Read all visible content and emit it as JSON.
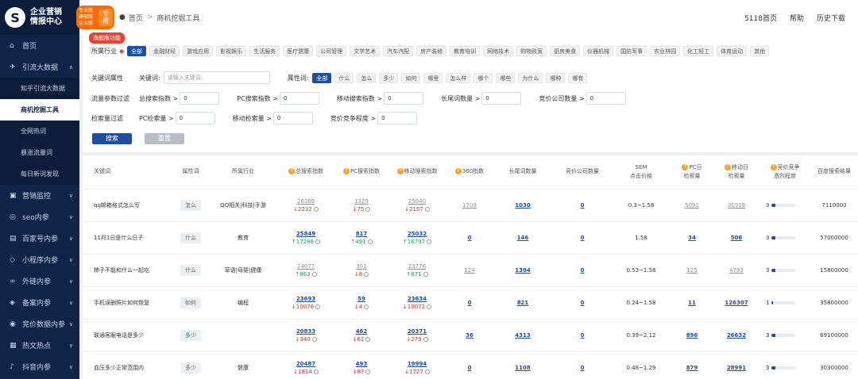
{
  "brand": {
    "logo_letter": "S",
    "line1": "企业营销",
    "line2": "情报中心"
  },
  "edition": {
    "lines": [
      "专业版",
      "旗舰版",
      "企业版"
    ],
    "label": "专用"
  },
  "breadcrumb": {
    "home": "首页",
    "sep": ">",
    "current": "商机挖掘工具"
  },
  "top_links": [
    "5118首页",
    "帮助",
    "历史下载"
  ],
  "sidebar": [
    {
      "icon": "home-icon",
      "glyph": "⌂",
      "label": "首页",
      "arrow": ""
    },
    {
      "icon": "traffic-icon",
      "glyph": "✈",
      "label": "引流大数据",
      "arrow": "∧"
    },
    {
      "label": "知乎引流大数据",
      "sub": true
    },
    {
      "label": "商机挖掘工具",
      "sub": true,
      "active": true
    },
    {
      "label": "全网热词",
      "sub": true
    },
    {
      "label": "暴涨流量词",
      "sub": true
    },
    {
      "label": "每日新词发现",
      "sub": true
    },
    {
      "icon": "monitor-icon",
      "glyph": "▣",
      "label": "营销监控",
      "arrow": "∨"
    },
    {
      "icon": "seo-icon",
      "glyph": "◎",
      "label": "seo内参",
      "arrow": "∨"
    },
    {
      "icon": "baijia-icon",
      "glyph": "▤",
      "label": "百家号内参",
      "arrow": "∨"
    },
    {
      "icon": "miniapp-icon",
      "glyph": "◇",
      "label": "小程序内参",
      "arrow": "∨"
    },
    {
      "icon": "link-icon",
      "glyph": "∞",
      "label": "外链内参",
      "arrow": "∨"
    },
    {
      "icon": "record-icon",
      "glyph": "◈",
      "label": "备案内参",
      "arrow": "∨"
    },
    {
      "icon": "bid-icon",
      "glyph": "◉",
      "label": "竞价数据内参",
      "arrow": "∨"
    },
    {
      "icon": "hot-icon",
      "glyph": "▦",
      "label": "热文热点",
      "arrow": "∨"
    },
    {
      "icon": "douyin-icon",
      "glyph": "♪",
      "label": "抖音内参",
      "arrow": "∨"
    }
  ],
  "filters": {
    "flag": "旗舰版功能",
    "industry_label": "所属行业",
    "industries": [
      "全部",
      "金融财经",
      "游戏应用",
      "影视娱乐",
      "生活服务",
      "医疗健康",
      "公司管理",
      "文学艺术",
      "汽车汽配",
      "房产装修",
      "教育培训",
      "网络技术",
      "购物败家",
      "厨房美食",
      "仪器机械",
      "国防军事",
      "农业林园",
      "化工轻工",
      "体育运动",
      "其他"
    ],
    "attr_section": "关键词属性",
    "keyword_label": "关键词:",
    "keyword_placeholder": "请输入关键词",
    "attr_label": "属性词:",
    "attrs": [
      "全部",
      "什么",
      "怎么",
      "多少",
      "如何",
      "哪里",
      "怎么样",
      "哪个",
      "哪些",
      "为什么",
      "哪种",
      "哪有"
    ],
    "flow_section": "流量参数过滤",
    "flow_fields": [
      {
        "label": "总搜索指数 >",
        "value": "0"
      },
      {
        "label": "PC搜索指数 >",
        "value": "0"
      },
      {
        "label": "移动搜索指数 >",
        "value": "0"
      },
      {
        "label": "长尾词数量 >",
        "value": "0"
      },
      {
        "label": "竞价公司数量 >",
        "value": "0"
      }
    ],
    "search_section": "检索量过滤",
    "search_fields": [
      {
        "label": "PC检索量 >",
        "value": "0"
      },
      {
        "label": "移动检索量 >",
        "value": "0"
      },
      {
        "label": "竞价竞争程度 >",
        "value": "0"
      }
    ],
    "search_button": "搜索",
    "reset_button": "重置"
  },
  "table": {
    "headers": [
      {
        "text": "关键词"
      },
      {
        "text": "属性词"
      },
      {
        "text": "所属行业"
      },
      {
        "text": "总搜索指数",
        "q": true
      },
      {
        "text": "PC搜索指数",
        "q": true
      },
      {
        "text": "移动搜索指数",
        "q": true
      },
      {
        "text": "360指数",
        "q": true
      },
      {
        "text": "长尾词数量"
      },
      {
        "text": "竞价公司数量"
      },
      {
        "text": "SEM",
        "text2": "点击价格"
      },
      {
        "text": "PC日",
        "text2": "检索量",
        "q": true
      },
      {
        "text": "移动日",
        "text2": "检索量",
        "q": true
      },
      {
        "text": "竞价竞争",
        "text2": "激烈程度",
        "q": true
      },
      {
        "text": "百度搜索结果"
      }
    ],
    "rows": [
      {
        "keyword": "qq邮箱格式怎么写",
        "attr": "怎么",
        "industry": "QQ相关|科技|手游",
        "total": "26369",
        "total_d": "2232",
        "total_dir": "down",
        "total_link": false,
        "pc": "1329",
        "pc_d": "75",
        "pc_dir": "down",
        "pc_link": false,
        "mob": "25040",
        "mob_d": "2157",
        "mob_dir": "down",
        "mob_link": false,
        "i360": "1709",
        "i360_link": false,
        "longtail": "1030",
        "bid_co": "0",
        "sem": "0.3~1.58",
        "pc_day": "5091",
        "pc_day_link": false,
        "mob_day": "31918",
        "mob_day_link": false,
        "comp": "3",
        "comp_level": 0.15,
        "baidu": "7110000"
      },
      {
        "keyword": "11月1日是什么日子",
        "attr": "什么",
        "industry": "教育",
        "total": "25849",
        "total_d": "17288",
        "total_dir": "up",
        "total_link": true,
        "pc": "817",
        "pc_d": "491",
        "pc_dir": "up",
        "pc_link": true,
        "mob": "25032",
        "mob_d": "16797",
        "mob_dir": "up",
        "mob_link": true,
        "i360": "0",
        "i360_link": true,
        "longtail": "146",
        "bid_co": "0",
        "sem": "1.58",
        "pc_day": "34",
        "pc_day_link": true,
        "mob_day": "506",
        "mob_day_link": true,
        "comp": "3",
        "comp_level": 0.15,
        "baidu": "57000000"
      },
      {
        "keyword": "柿子不能和什么一起吃",
        "attr": "什么",
        "industry": "草语|母婴|健康",
        "total": "24077",
        "total_d": "863",
        "total_dir": "up",
        "total_link": false,
        "pc": "301",
        "pc_d": "8",
        "pc_dir": "down",
        "pc_link": false,
        "mob": "23776",
        "mob_d": "871",
        "mob_dir": "up",
        "mob_link": false,
        "i360": "124",
        "i360_link": false,
        "longtail": "1394",
        "bid_co": "0",
        "sem": "0.53~1.58",
        "pc_day": "125",
        "pc_day_link": false,
        "mob_day": "4793",
        "mob_day_link": false,
        "comp": "3",
        "comp_level": 0.15,
        "baidu": "15800000"
      },
      {
        "keyword": "手机误删照片如何恢复",
        "attr": "如何",
        "industry": "编程",
        "total": "23693",
        "total_d": "10076",
        "total_dir": "down",
        "total_link": true,
        "pc": "59",
        "pc_d": "4",
        "pc_dir": "down",
        "pc_link": true,
        "mob": "23634",
        "mob_d": "10072",
        "mob_dir": "down",
        "mob_link": true,
        "i360": "0",
        "i360_link": true,
        "longtail": "821",
        "bid_co": "0",
        "sem": "0.24~1.58",
        "pc_day": "11",
        "pc_day_link": true,
        "mob_day": "126307",
        "mob_day_link": true,
        "comp": "1",
        "comp_level": 0.05,
        "baidu": "35800000"
      },
      {
        "keyword": "联通客服电话是多少",
        "attr": "多少",
        "industry": "",
        "total": "20833",
        "total_d": "340",
        "total_dir": "down",
        "total_link": true,
        "pc": "462",
        "pc_d": "61",
        "pc_dir": "down",
        "pc_link": true,
        "mob": "20371",
        "mob_d": "279",
        "mob_dir": "down",
        "mob_link": true,
        "i360": "36",
        "i360_link": true,
        "longtail": "4313",
        "bid_co": "0",
        "sem": "0.39~2.12",
        "pc_day": "896",
        "pc_day_link": true,
        "mob_day": "26632",
        "mob_day_link": true,
        "comp": "3",
        "comp_level": 0.15,
        "baidu": "69100000"
      },
      {
        "keyword": "血压多少正常范围内",
        "attr": "多少",
        "industry": "健康",
        "total": "20487",
        "total_d": "1814",
        "total_dir": "down",
        "total_link": true,
        "pc": "493",
        "pc_d": "87",
        "pc_dir": "down",
        "pc_link": true,
        "mob": "19994",
        "mob_d": "1727",
        "mob_dir": "down",
        "mob_link": true,
        "i360": "0",
        "i360_link": true,
        "longtail": "1108",
        "bid_co": "0",
        "sem": "0.48~1.29",
        "pc_day": "879",
        "pc_day_link": true,
        "mob_day": "28991",
        "mob_day_link": true,
        "comp": "3",
        "comp_level": 0.15,
        "baidu": "30300000"
      }
    ]
  }
}
